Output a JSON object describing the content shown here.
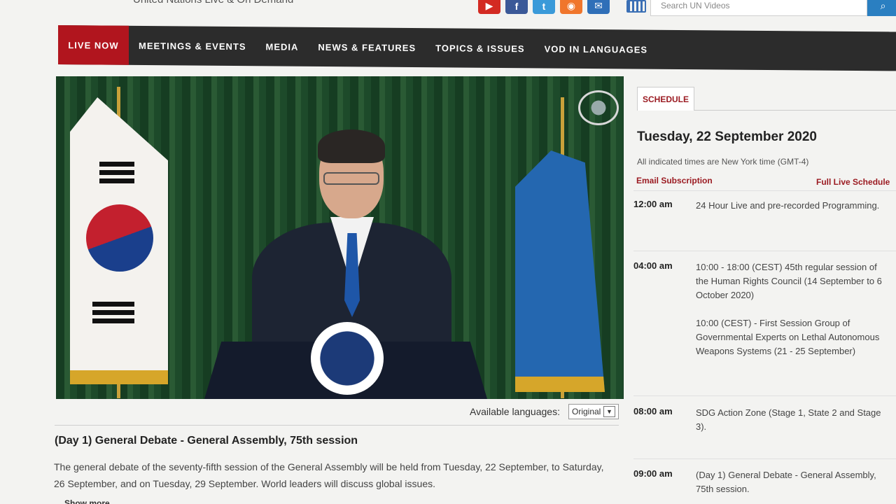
{
  "header": {
    "tagline": "United Nations Live & On Demand",
    "search_placeholder": "Search UN Videos",
    "social": [
      {
        "icon": "youtube-icon",
        "glyph": "▶",
        "color": "#d32a22"
      },
      {
        "icon": "facebook-icon",
        "glyph": "f",
        "color": "#3b5998"
      },
      {
        "icon": "twitter-icon",
        "glyph": "t",
        "color": "#3a9ad9"
      },
      {
        "icon": "rss-icon",
        "glyph": "◉",
        "color": "#f0762c"
      },
      {
        "icon": "email-icon",
        "glyph": "✉",
        "color": "#2f6fb8"
      }
    ]
  },
  "nav": {
    "items": [
      "LIVE NOW",
      "MEETINGS & EVENTS",
      "MEDIA",
      "NEWS & FEATURES",
      "TOPICS & ISSUES",
      "VOD IN LANGUAGES"
    ]
  },
  "player": {
    "languages_label": "Available languages:",
    "selected_language": "Original"
  },
  "event": {
    "title": "(Day 1) General Debate - General Assembly, 75th session",
    "description": "The general debate of the seventy-fifth session of the General Assembly will be held from Tuesday, 22 September, to Saturday, 26 September, and on Tuesday, 29 September. World leaders will discuss global issues.",
    "show_more": "Show more"
  },
  "schedule": {
    "tab_label": "SCHEDULE",
    "date": "Tuesday, 22 September 2020",
    "timezone_note": "All indicated times are New York time (GMT-4)",
    "email_subscription": "Email Subscription",
    "full_schedule": "Full Live Schedule",
    "rows": [
      {
        "time": "12:00 am",
        "entries": [
          "24 Hour Live and pre-recorded Programming."
        ]
      },
      {
        "time": "04:00 am",
        "entries": [
          "10:00 - 18:00 (CEST) 45th regular session of the Human Rights Council (14 September to 6 October 2020)",
          "10:00 (CEST) - First Session Group of Governmental Experts on Lethal Autonomous Weapons Systems (21 - 25 September)"
        ]
      },
      {
        "time": "08:00 am",
        "entries": [
          "SDG Action Zone (Stage 1, State 2 and Stage 3)."
        ]
      },
      {
        "time": "09:00 am",
        "entries": [
          "(Day 1) General Debate - General Assembly, 75th session."
        ]
      }
    ]
  }
}
